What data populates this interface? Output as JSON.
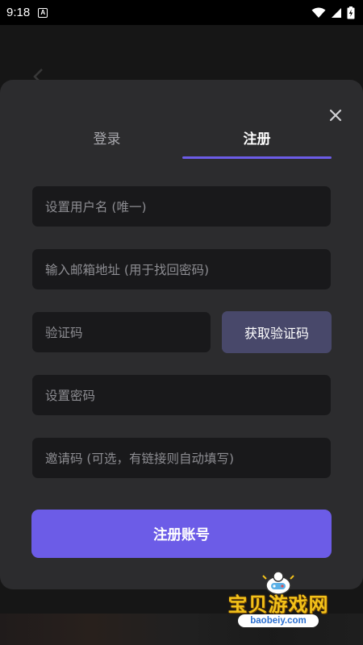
{
  "status_bar": {
    "time": "9:18",
    "notification_icon": "A",
    "icons": [
      "wifi-icon",
      "signal-icon",
      "battery-charging-icon"
    ]
  },
  "dialog": {
    "close_icon": "close-icon",
    "tabs": [
      {
        "label": "登录",
        "active": false
      },
      {
        "label": "注册",
        "active": true
      }
    ],
    "fields": {
      "username": {
        "placeholder": "设置用户名 (唯一)",
        "value": ""
      },
      "email": {
        "placeholder": "输入邮箱地址 (用于找回密码)",
        "value": ""
      },
      "code": {
        "placeholder": "验证码",
        "value": ""
      },
      "password": {
        "placeholder": "设置密码",
        "value": ""
      },
      "invite": {
        "placeholder": "邀请码 (可选，有链接则自动填写)",
        "value": ""
      }
    },
    "get_code_label": "获取验证码",
    "submit_label": "注册账号"
  },
  "watermark": {
    "title": "宝贝游戏网",
    "url": "baobeiy.com"
  },
  "colors": {
    "accent": "#6c5ce7",
    "card_bg": "#2c2c2e",
    "input_bg": "#19191b",
    "secondary_button": "#48486a"
  }
}
